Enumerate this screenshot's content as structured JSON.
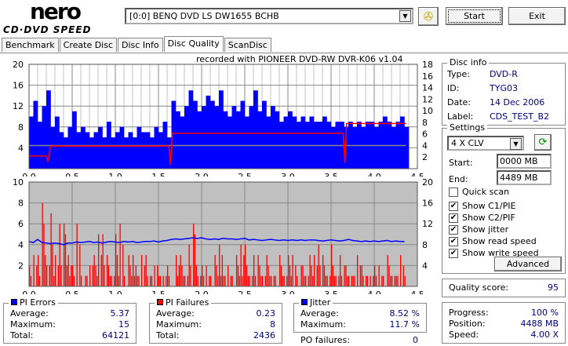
{
  "app": {
    "logo_top": "nero",
    "logo_bottom": "CD·DVD SPEED"
  },
  "toolbar": {
    "drive": "[0:0]  BENQ DVD LS DW1655 BCHB",
    "start": "Start",
    "exit": "Exit"
  },
  "tabs": [
    {
      "label": "Benchmark"
    },
    {
      "label": "Create Disc"
    },
    {
      "label": "Disc Info"
    },
    {
      "label": "Disc Quality",
      "active": true
    },
    {
      "label": "ScanDisc"
    }
  ],
  "chart_header": "recorded with PIONEER DVD-RW  DVR-K06  v1.04",
  "disc_info": {
    "title": "Disc info",
    "type_label": "Type:",
    "type": "DVD-R",
    "id_label": "ID:",
    "id": "TYG03",
    "date_label": "Date:",
    "date": "14 Dec 2006",
    "label_label": "Label:",
    "label": "CDS_TEST_B2"
  },
  "settings": {
    "title": "Settings",
    "speed": "4 X CLV",
    "start_label": "Start:",
    "start": "0000 MB",
    "end_label": "End:",
    "end": "4489 MB",
    "checks": [
      {
        "label": "Quick scan",
        "checked": false
      },
      {
        "label": "Show C1/PIE",
        "checked": true
      },
      {
        "label": "Show C2/PIF",
        "checked": true
      },
      {
        "label": "Show jitter",
        "checked": true
      },
      {
        "label": "Show read speed",
        "checked": true
      },
      {
        "label": "Show write speed",
        "checked": true
      }
    ],
    "advanced": "Advanced"
  },
  "quality": {
    "label": "Quality score:",
    "value": "95"
  },
  "progress": {
    "progress_label": "Progress:",
    "progress": "100 %",
    "position_label": "Position:",
    "position": "4488 MB",
    "speed_label": "Speed:",
    "speed": "4.00 X"
  },
  "pi_errors": {
    "title": "PI Errors",
    "color": "#0000ff",
    "average_label": "Average:",
    "average": "5.37",
    "maximum_label": "Maximum:",
    "maximum": "15",
    "total_label": "Total:",
    "total": "64121"
  },
  "pi_failures": {
    "title": "PI Failures",
    "color": "#ff0000",
    "average_label": "Average:",
    "average": "0.23",
    "maximum_label": "Maximum:",
    "maximum": "8",
    "total_label": "Total:",
    "total": "2436"
  },
  "jitter": {
    "title": "Jitter",
    "color": "#0000ff",
    "average_label": "Average:",
    "average": "8.52 %",
    "maximum_label": "Maximum:",
    "maximum": "11.7 %",
    "po_label": "PO failures:",
    "po": "0"
  },
  "chart_data": [
    {
      "type": "bar",
      "name": "PI Errors",
      "x_step": 0.05,
      "xlim": [
        0,
        4.5
      ],
      "ylim": [
        0,
        20
      ],
      "y2lim": [
        0,
        18
      ],
      "xticks": [
        "0.0",
        "0.5",
        "1.0",
        "1.5",
        "2.0",
        "2.5",
        "3.0",
        "3.5",
        "4.0",
        "4.5"
      ],
      "yticks": [
        "4",
        "8",
        "12",
        "16",
        "20"
      ],
      "y2ticks": [
        "2",
        "4",
        "6",
        "8",
        "10",
        "12",
        "14",
        "16",
        "18"
      ],
      "values": [
        10,
        13,
        9,
        12,
        15,
        8,
        10,
        7,
        6,
        8,
        11,
        7,
        8,
        7,
        6,
        7,
        8,
        6,
        9,
        6,
        7,
        8,
        6,
        7,
        6,
        8,
        7,
        7,
        6,
        8,
        7,
        9,
        6,
        13,
        11,
        10,
        12,
        15,
        13,
        11,
        12,
        14,
        13,
        12,
        15,
        11,
        10,
        12,
        11,
        13,
        10,
        12,
        15,
        11,
        13,
        10,
        12,
        11,
        9,
        10,
        11,
        10,
        9,
        10,
        9,
        10,
        9,
        9,
        10,
        9,
        8,
        9,
        9,
        8,
        9,
        8,
        9,
        8,
        9,
        9,
        8,
        9,
        10,
        9,
        8,
        9,
        10,
        8
      ],
      "read_speed": [
        [
          0,
          2.2
        ],
        [
          0.2,
          2.2
        ],
        [
          0.22,
          1.2
        ],
        [
          0.25,
          3.9
        ],
        [
          1.62,
          3.9
        ],
        [
          1.64,
          0.6
        ],
        [
          1.66,
          6.1
        ],
        [
          3.64,
          6.1
        ],
        [
          3.66,
          1.0
        ],
        [
          3.68,
          7.8
        ],
        [
          4.37,
          7.8
        ]
      ],
      "write_speed": 4
    },
    {
      "type": "bar",
      "name": "PI Failures",
      "x_step": 0.05,
      "xlim": [
        0,
        4.5
      ],
      "ylim": [
        0,
        10
      ],
      "y2lim": [
        0,
        20
      ],
      "xticks": [
        "0.0",
        "0.5",
        "1.0",
        "1.5",
        "2.0",
        "2.5",
        "3.0",
        "3.5",
        "4.0",
        "4.5"
      ],
      "yticks": [
        "2",
        "4",
        "6",
        "8",
        "10"
      ],
      "y2ticks": [
        "4",
        "8",
        "12",
        "16",
        "20"
      ],
      "values": [
        2,
        3,
        3,
        8,
        2,
        7,
        3,
        6,
        6,
        3,
        2,
        6,
        1,
        1,
        2,
        3,
        5,
        5,
        3,
        1,
        5,
        6,
        1,
        3,
        3,
        1,
        3,
        3,
        1,
        2,
        1,
        1,
        2,
        0,
        3,
        3,
        1,
        4,
        6,
        1,
        2,
        2,
        1,
        3,
        4,
        1,
        2,
        1,
        3,
        4,
        4,
        1,
        3,
        3,
        1,
        3,
        1,
        1,
        3,
        1,
        3,
        3,
        1,
        2,
        1,
        3,
        3,
        4,
        3,
        1,
        4,
        1,
        3,
        2,
        1,
        1,
        3,
        2,
        1,
        1,
        2,
        2,
        1,
        3,
        1,
        1,
        3,
        1
      ],
      "jitter": [
        8.6,
        8.4,
        9.0,
        8.4,
        8.3,
        8.2,
        8.3,
        8.2,
        8.0,
        8.3,
        8.3,
        8.5,
        8.4,
        8.5,
        8.6,
        8.4,
        8.5,
        8.3,
        8.5,
        8.6,
        8.5,
        8.4,
        8.6,
        8.5,
        8.6,
        8.4,
        8.5,
        8.6,
        8.6,
        8.7,
        8.5,
        8.7,
        8.8,
        9.0,
        9.1,
        9.0,
        9.1,
        9.2,
        9.3,
        9.2,
        9.3,
        9.1,
        9.0,
        9.1,
        9.0,
        9.2,
        9.1,
        9.1,
        9.0,
        9.1,
        9.2,
        8.9,
        9.0,
        8.9,
        8.8,
        8.9,
        9.0,
        8.9,
        8.8,
        8.9,
        8.8,
        8.9,
        8.8,
        8.9,
        8.8,
        8.9,
        8.9,
        8.8,
        8.7,
        8.8,
        8.9,
        8.8,
        8.7,
        8.8,
        9.0,
        8.8,
        8.7,
        8.6,
        8.7,
        8.6,
        8.7,
        8.6,
        8.7,
        8.8,
        8.6,
        8.7,
        8.6,
        8.6
      ]
    }
  ]
}
